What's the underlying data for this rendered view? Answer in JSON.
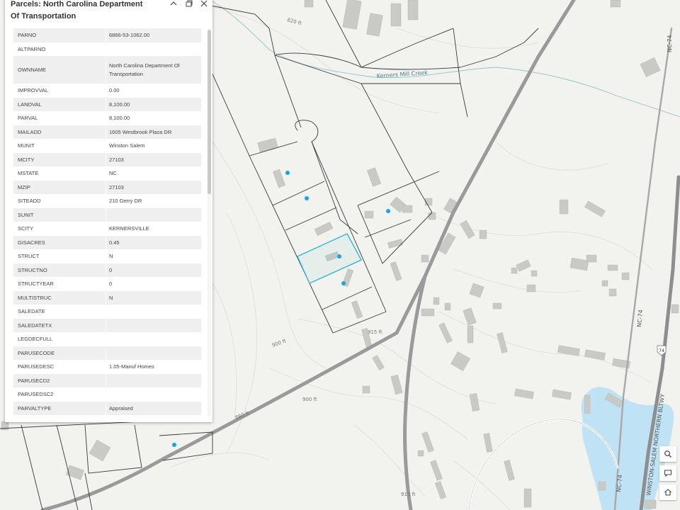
{
  "popup": {
    "title": "Parcels: North Carolina Department Of Transportation",
    "rows": [
      {
        "key": "PARNO",
        "value": "6866-53-1062.00"
      },
      {
        "key": "ALTPARNO",
        "value": ""
      },
      {
        "key": "OWNNAME",
        "value": "North Carolina Department Of Transportation"
      },
      {
        "key": "IMPROVVAL",
        "value": "0.00"
      },
      {
        "key": "LANDVAL",
        "value": "8,100.00"
      },
      {
        "key": "PARVAL",
        "value": "8,100.00"
      },
      {
        "key": "MAILADD",
        "value": "1605 Westbrook Plaza DR"
      },
      {
        "key": "MUNIT",
        "value": "Winston Salem"
      },
      {
        "key": "MCITY",
        "value": "27103"
      },
      {
        "key": "MSTATE",
        "value": "NC"
      },
      {
        "key": "MZIP",
        "value": "27103"
      },
      {
        "key": "SITEADD",
        "value": "210 Gerry DR"
      },
      {
        "key": "SUNIT",
        "value": ""
      },
      {
        "key": "SCITY",
        "value": "KERNERSVILLE"
      },
      {
        "key": "GISACRES",
        "value": "0.45"
      },
      {
        "key": "STRUCT",
        "value": "N"
      },
      {
        "key": "STRUCTNO",
        "value": "0"
      },
      {
        "key": "STRUCTYEAR",
        "value": "0"
      },
      {
        "key": "MULTISTRUC",
        "value": "N"
      },
      {
        "key": "SALEDATE",
        "value": ""
      },
      {
        "key": "SALEDATETX",
        "value": ""
      },
      {
        "key": "LEGDECFULL",
        "value": ""
      },
      {
        "key": "PARUSECODE",
        "value": ""
      },
      {
        "key": "PARUSEDESC",
        "value": "1.05-Manuf Homes"
      },
      {
        "key": "PARUSECD2",
        "value": ""
      },
      {
        "key": "PARUSEDSC2",
        "value": ""
      },
      {
        "key": "PARVALTYPE",
        "value": "Appraised"
      },
      {
        "key": "OWNTYPE",
        "value": ""
      }
    ]
  },
  "map_labels": {
    "creek": "Kerners Mill Creek",
    "contour_820": "820 ft",
    "contour_915": "915 ft",
    "contour_900a": "900 ft",
    "contour_900b": "900 ft",
    "contour_880": "880 ft",
    "contour_915b": "915 ft",
    "road_nc74_top": "NC-74",
    "road_nc74_mid": "NC-74",
    "road_nc74_bottom": "NC-74",
    "road_beltway": "WINSTON-SALEM NORTHERN BLTWY",
    "shield_74": "74"
  },
  "colors": {
    "map_background": "#f2f2ee",
    "parcel_line": "#3a3a3a",
    "selected_parcel": "#35b8d0",
    "point": "#1ca3e0",
    "road": "#9a9a9a",
    "water": "#bfe3f5",
    "building": "#c9c9c6"
  },
  "icons": {
    "collapse": "chevron-up-icon",
    "dock": "dock-icon",
    "close": "close-icon",
    "search": "search-icon",
    "comment": "comment-icon",
    "home": "home-icon"
  }
}
